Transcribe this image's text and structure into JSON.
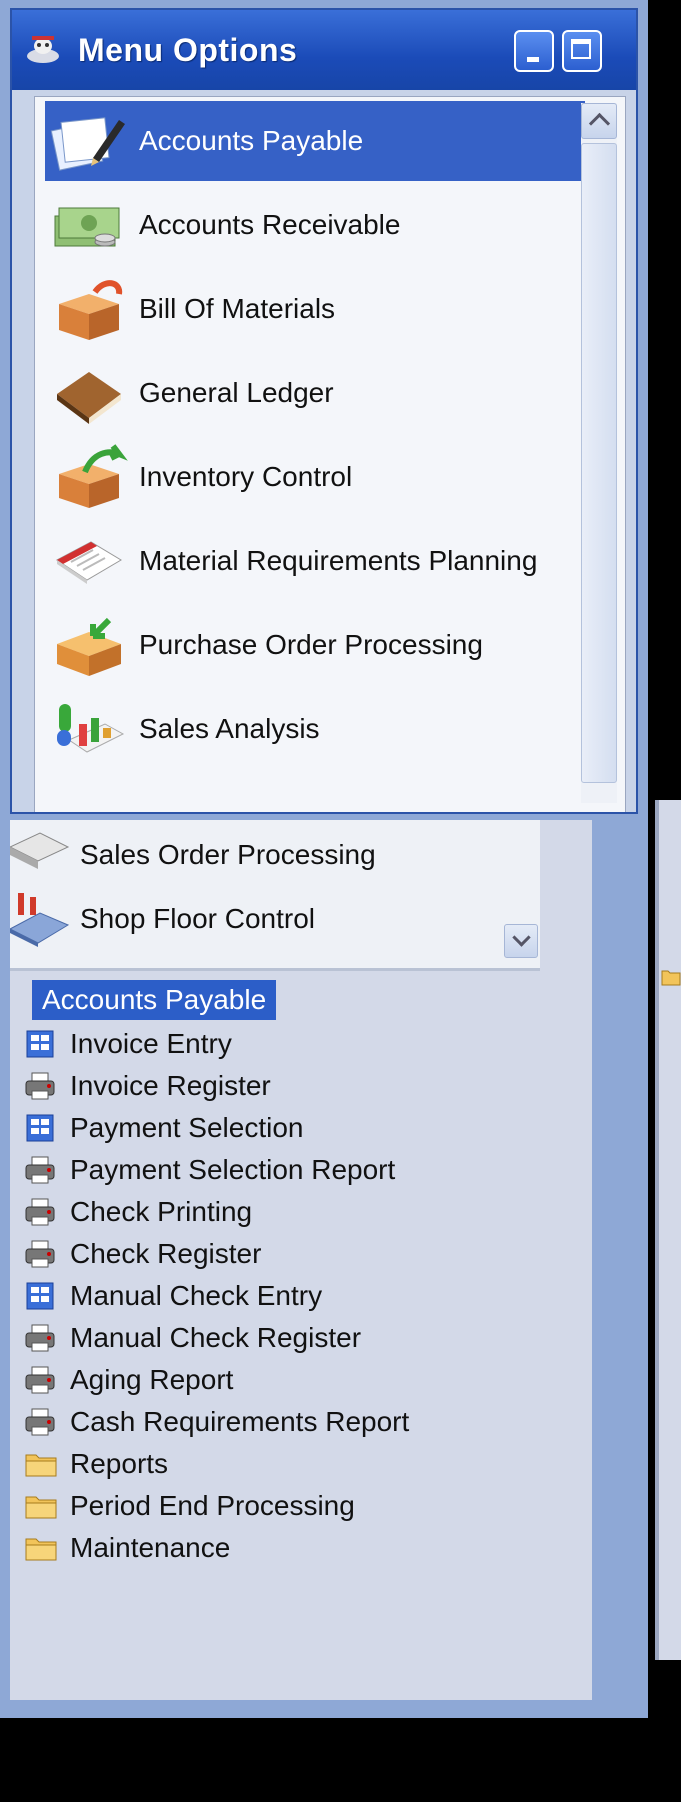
{
  "window": {
    "title": "Menu Options"
  },
  "menu": {
    "items": [
      {
        "label": "Accounts Payable",
        "icon": "accounts-payable-icon",
        "selected": true
      },
      {
        "label": "Accounts Receivable",
        "icon": "money-icon"
      },
      {
        "label": "Bill Of Materials",
        "icon": "box-icon"
      },
      {
        "label": "General Ledger",
        "icon": "ledger-book-icon"
      },
      {
        "label": "Inventory Control",
        "icon": "inventory-box-icon"
      },
      {
        "label": "Material Requirements Planning",
        "icon": "calendar-icon"
      },
      {
        "label": "Purchase Order Processing",
        "icon": "purchase-box-icon"
      },
      {
        "label": "Sales Analysis",
        "icon": "chart-icon"
      },
      {
        "label": "Sales Order Processing",
        "icon": "sales-order-icon"
      },
      {
        "label": "Shop Floor Control",
        "icon": "factory-icon"
      }
    ]
  },
  "tree": {
    "root": "Accounts Payable",
    "items": [
      {
        "label": "Invoice Entry",
        "icon": "form-icon"
      },
      {
        "label": "Invoice Register",
        "icon": "printer-icon"
      },
      {
        "label": "Payment Selection",
        "icon": "form-icon"
      },
      {
        "label": "Payment Selection Report",
        "icon": "printer-icon"
      },
      {
        "label": "Check Printing",
        "icon": "printer-icon"
      },
      {
        "label": "Check Register",
        "icon": "printer-icon"
      },
      {
        "label": "Manual Check Entry",
        "icon": "form-icon"
      },
      {
        "label": "Manual Check Register",
        "icon": "printer-icon"
      },
      {
        "label": "Aging Report",
        "icon": "printer-icon"
      },
      {
        "label": "Cash Requirements Report",
        "icon": "printer-icon"
      },
      {
        "label": "Reports",
        "icon": "folder-icon"
      },
      {
        "label": "Period End Processing",
        "icon": "folder-icon"
      },
      {
        "label": "Maintenance",
        "icon": "folder-icon"
      }
    ]
  },
  "colors": {
    "selection": "#3661c6",
    "titlebar": "#1b4bb8"
  }
}
